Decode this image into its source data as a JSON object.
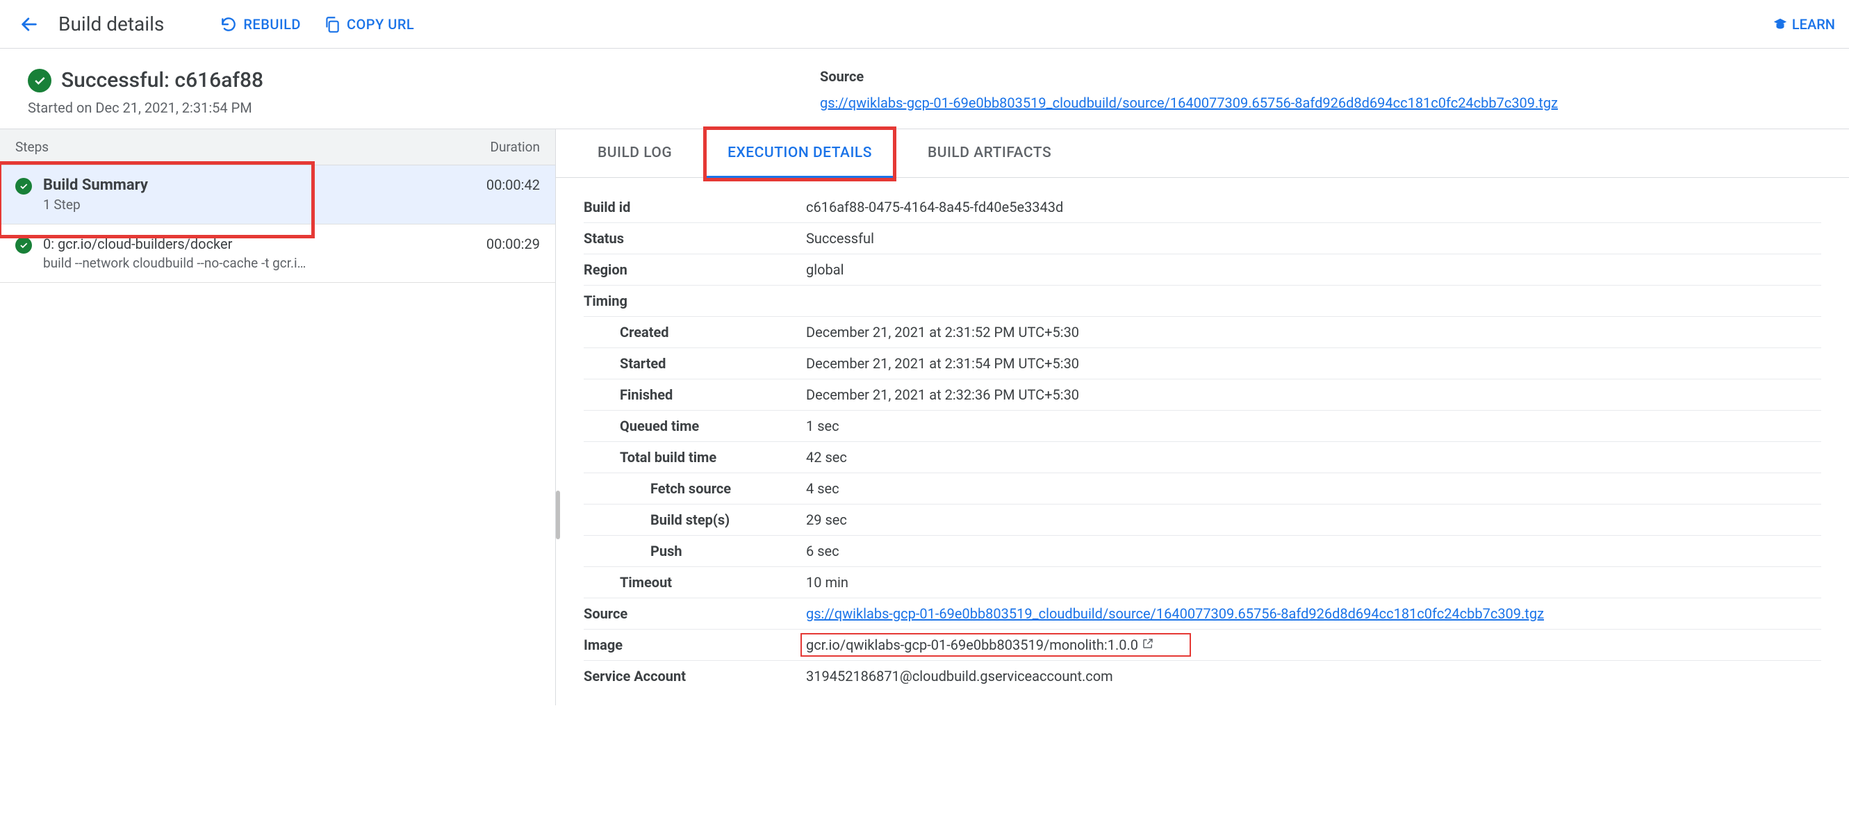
{
  "header": {
    "title": "Build details",
    "rebuild_label": "REBUILD",
    "copy_url_label": "COPY URL",
    "learn_label": "LEARN"
  },
  "status": {
    "title_prefix": "Successful:",
    "build_short_id": "c616af88",
    "started_on": "Started on Dec 21, 2021, 2:31:54 PM"
  },
  "source": {
    "label": "Source",
    "url": "gs://qwiklabs-gcp-01-69e0bb803519_cloudbuild/source/1640077309.65756-8afd926d8d694cc181c0fc24cbb7c309.tgz"
  },
  "steps_panel": {
    "col_steps": "Steps",
    "col_duration": "Duration",
    "items": [
      {
        "title": "Build Summary",
        "sub": "1 Step",
        "duration": "00:00:42",
        "selected": true,
        "highlighted": true,
        "bold": true
      },
      {
        "title": "0: gcr.io/cloud-builders/docker",
        "sub": "build --network cloudbuild --no-cache -t gcr.i…",
        "duration": "00:00:29",
        "selected": false,
        "highlighted": false,
        "bold": false
      }
    ]
  },
  "tabs": {
    "build_log": "BUILD LOG",
    "execution_details": "EXECUTION DETAILS",
    "build_artifacts": "BUILD ARTIFACTS",
    "active": "execution_details"
  },
  "details": {
    "build_id": {
      "label": "Build id",
      "value": "c616af88-0475-4164-8a45-fd40e5e3343d"
    },
    "status": {
      "label": "Status",
      "value": "Successful"
    },
    "region": {
      "label": "Region",
      "value": "global"
    },
    "timing": {
      "label": "Timing"
    },
    "created": {
      "label": "Created",
      "value": "December 21, 2021 at 2:31:52 PM UTC+5:30"
    },
    "started": {
      "label": "Started",
      "value": "December 21, 2021 at 2:31:54 PM UTC+5:30"
    },
    "finished": {
      "label": "Finished",
      "value": "December 21, 2021 at 2:32:36 PM UTC+5:30"
    },
    "queued": {
      "label": "Queued time",
      "value": "1 sec"
    },
    "total_build": {
      "label": "Total build time",
      "value": "42 sec"
    },
    "fetch_source": {
      "label": "Fetch source",
      "value": "4 sec"
    },
    "build_steps": {
      "label": "Build step(s)",
      "value": "29 sec"
    },
    "push": {
      "label": "Push",
      "value": "6 sec"
    },
    "timeout": {
      "label": "Timeout",
      "value": "10 min"
    },
    "source": {
      "label": "Source",
      "value": "gs://qwiklabs-gcp-01-69e0bb803519_cloudbuild/source/1640077309.65756-8afd926d8d694cc181c0fc24cbb7c309.tgz"
    },
    "image": {
      "label": "Image",
      "value": "gcr.io/qwiklabs-gcp-01-69e0bb803519/monolith:1.0.0"
    },
    "service_account": {
      "label": "Service Account",
      "value": "319452186871@cloudbuild.gserviceaccount.com"
    }
  }
}
